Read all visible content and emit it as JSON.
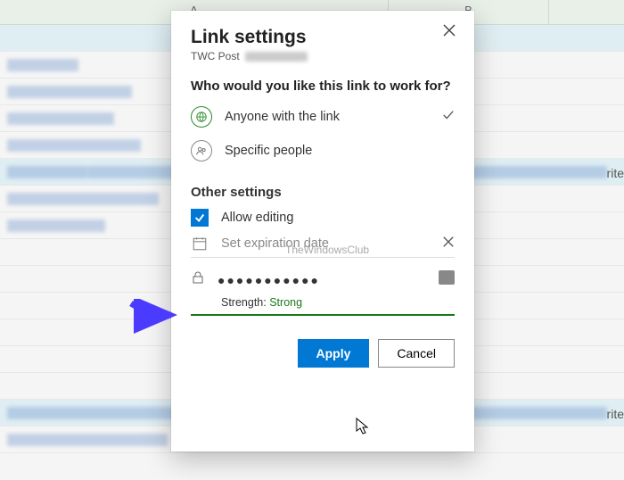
{
  "bg": {
    "colA": "A",
    "colB": "B",
    "rite": "rite"
  },
  "dialog": {
    "title": "Link settings",
    "subtitle": "TWC Post",
    "question": "Who would you like this link to work for?",
    "opt_anyone": "Anyone with the link",
    "opt_specific": "Specific people",
    "other_settings": "Other settings",
    "allow_editing": "Allow editing",
    "expiration_placeholder": "Set expiration date",
    "password_value": "●●●●●●●●●●●",
    "strength_label": "Strength:",
    "strength_value": "Strong",
    "apply": "Apply",
    "cancel": "Cancel"
  },
  "watermark": "TheWindowsClub"
}
